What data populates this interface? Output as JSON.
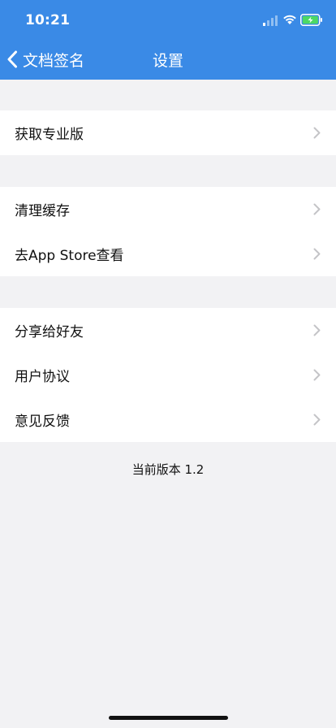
{
  "status_bar": {
    "time": "10:21",
    "signal_icon": "cellular-signal-icon",
    "wifi_icon": "wifi-icon",
    "battery_icon": "battery-charging-icon"
  },
  "nav": {
    "back_label": "文档签名",
    "back_icon": "chevron-left-icon",
    "title": "设置"
  },
  "groups": [
    {
      "items": [
        {
          "label": "获取专业版",
          "icon": "chevron-right-icon"
        }
      ]
    },
    {
      "items": [
        {
          "label": "清理缓存",
          "icon": "chevron-right-icon"
        },
        {
          "label": "去App Store查看",
          "icon": "chevron-right-icon"
        }
      ]
    },
    {
      "items": [
        {
          "label": "分享给好友",
          "icon": "chevron-right-icon"
        },
        {
          "label": "用户协议",
          "icon": "chevron-right-icon"
        },
        {
          "label": "意见反馈",
          "icon": "chevron-right-icon"
        }
      ]
    }
  ],
  "version_text": "当前版本 1.2",
  "colors": {
    "nav_background": "#3a8ae6",
    "page_background": "#f2f2f4",
    "cell_background": "#ffffff",
    "chevron": "#c4c4c7",
    "battery_fill": "#4cd964"
  }
}
